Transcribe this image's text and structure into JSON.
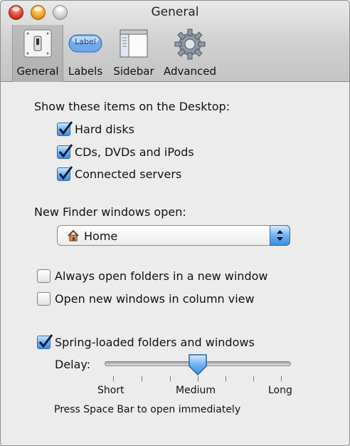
{
  "window": {
    "title": "General"
  },
  "toolbar": {
    "items": [
      {
        "label": "General",
        "icon": "light-switch-icon"
      },
      {
        "label": "Labels",
        "icon": "label-tag-icon",
        "badge_text": "Label"
      },
      {
        "label": "Sidebar",
        "icon": "sidebar-window-icon"
      },
      {
        "label": "Advanced",
        "icon": "gear-icon"
      }
    ],
    "selected": "General"
  },
  "desktop": {
    "heading": "Show these items on the Desktop:",
    "items": [
      {
        "label": "Hard disks",
        "checked": true
      },
      {
        "label": "CDs, DVDs and iPods",
        "checked": true
      },
      {
        "label": "Connected servers",
        "checked": true
      }
    ]
  },
  "finder": {
    "heading": "New Finder windows open:",
    "selected_value": "Home",
    "icon": "house-icon"
  },
  "options": [
    {
      "label": "Always open folders in a new window",
      "checked": false
    },
    {
      "label": "Open new windows in column view",
      "checked": false
    }
  ],
  "spring": {
    "label": "Spring-loaded folders and windows",
    "checked": true,
    "delay_label": "Delay:",
    "ticks": [
      "Short",
      "Medium",
      "Long"
    ],
    "delay_value_fraction": 0.5,
    "hint": "Press Space Bar to open immediately"
  },
  "colors": {
    "accent": "#3d8de0",
    "metal": "#cfcfcf",
    "background": "#ececec"
  }
}
